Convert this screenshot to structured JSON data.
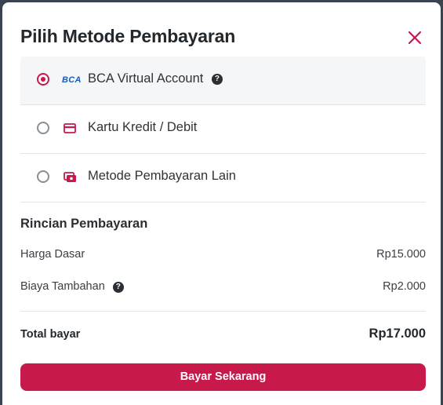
{
  "modal": {
    "title": "Pilih Metode Pembayaran"
  },
  "methods": [
    {
      "label": "BCA Virtual Account",
      "icon": "bca-logo-icon",
      "icon_text": "BCA",
      "selected": true,
      "has_help": true
    },
    {
      "label": "Kartu Kredit / Debit",
      "icon": "credit-card-icon",
      "selected": false
    },
    {
      "label": "Metode Pembayaran Lain",
      "icon": "wallet-icon",
      "selected": false
    }
  ],
  "details": {
    "title": "Rincian Pembayaran",
    "base_price_label": "Harga Dasar",
    "base_price_value": "Rp15.000",
    "extra_fee_label": "Biaya Tambahan",
    "extra_fee_value": "Rp2.000",
    "total_label": "Total bayar",
    "total_value": "Rp17.000"
  },
  "help_glyph": "?",
  "pay_button": {
    "label": "Bayar Sekarang"
  },
  "colors": {
    "accent": "#c8194b",
    "bca_blue": "#1a5bb8",
    "text": "#2b2f33"
  }
}
